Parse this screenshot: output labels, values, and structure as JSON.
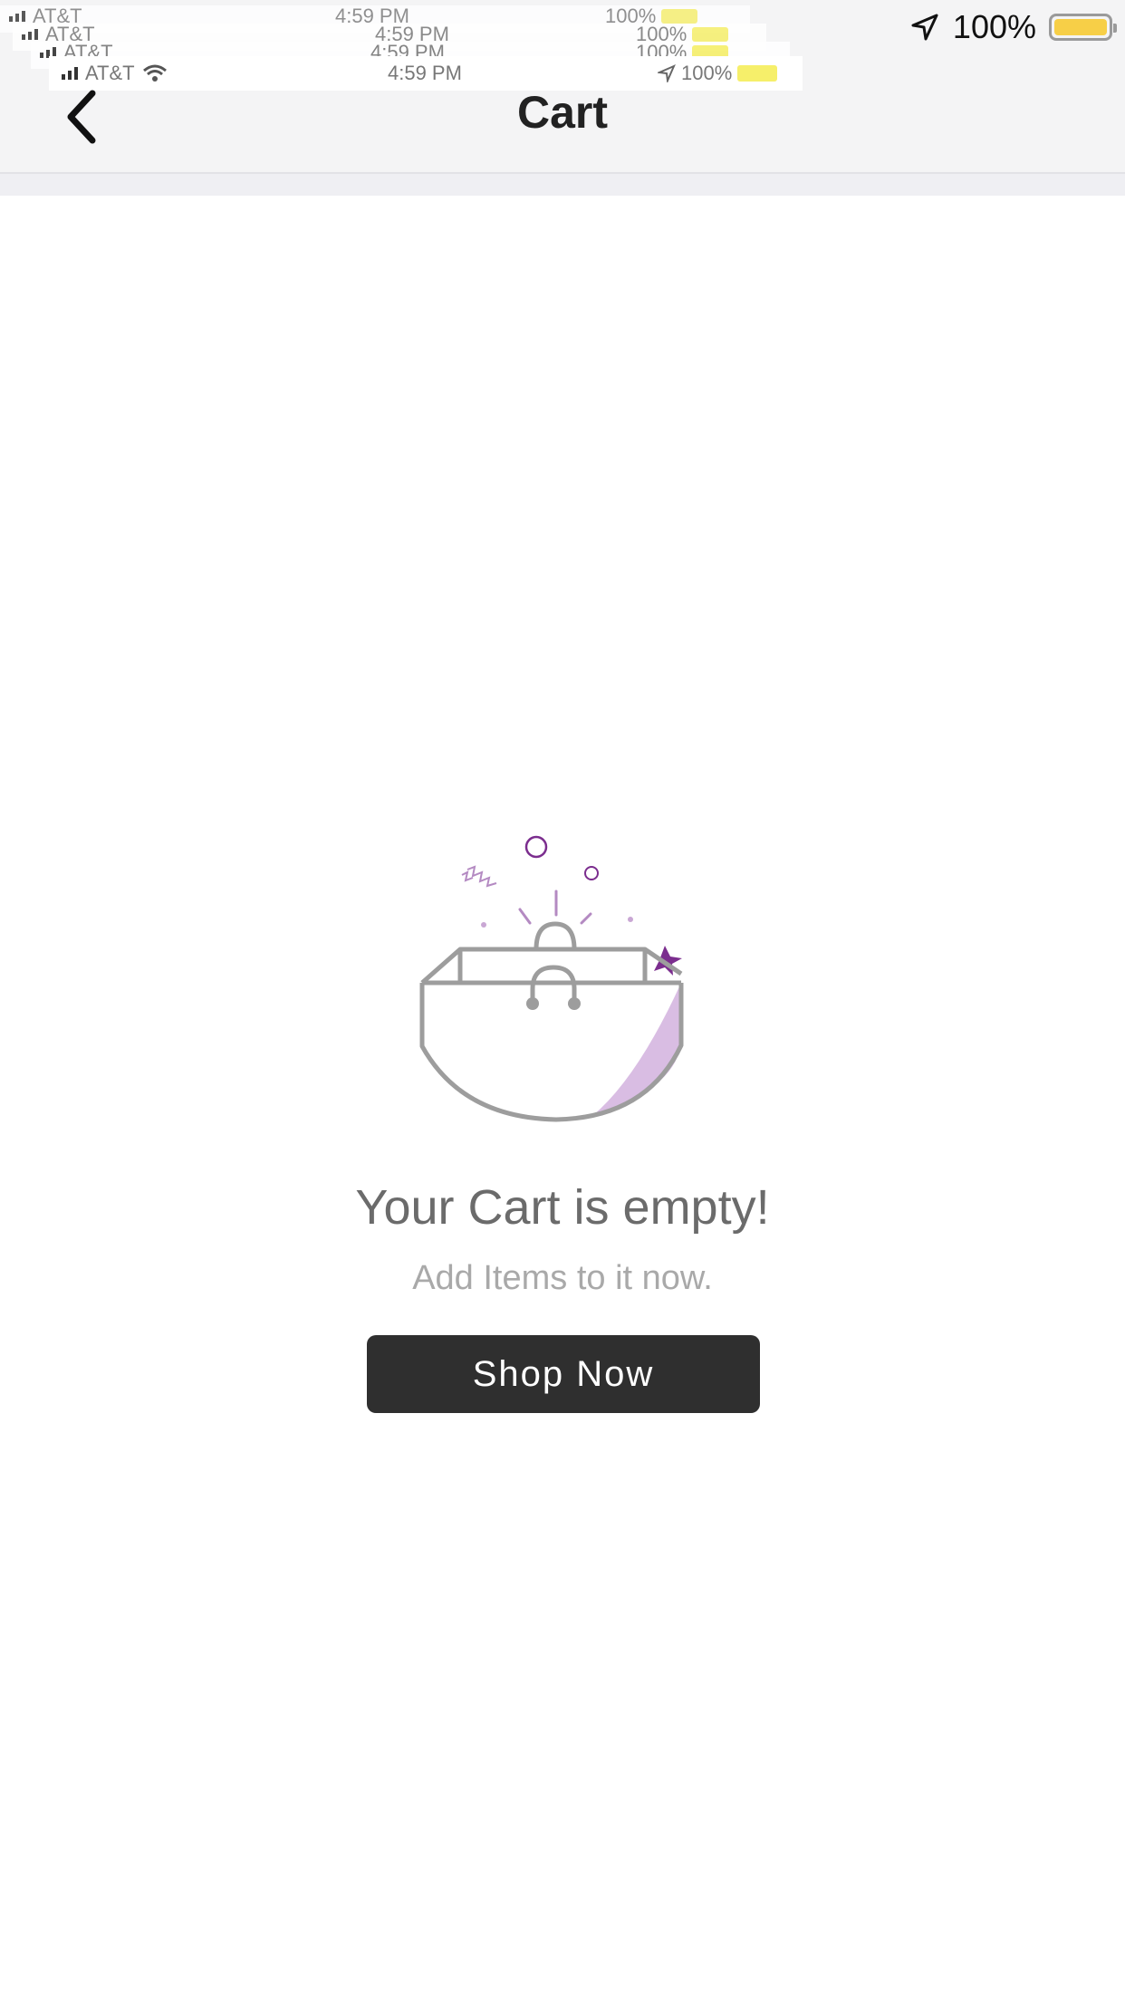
{
  "status_bar": {
    "carrier": "AT&T",
    "time": "4:59 PM",
    "battery_percent": "100%",
    "battery_level": 1.0,
    "battery_color": "#f7cf47"
  },
  "ghost_status": {
    "carrier": "AT&T",
    "time": "4:59 PM",
    "battery_percent": "100%"
  },
  "nav": {
    "title": "Cart",
    "back_icon": "chevron-left-icon"
  },
  "empty_state": {
    "illustration": "shopping-bag-icon",
    "title": "Your Cart is empty!",
    "subtitle": "Add Items to it now.",
    "button_label": "Shop Now"
  },
  "colors": {
    "accent_purple": "#7b2d8e",
    "light_purple": "#d9bde3",
    "button_bg": "#2f2f2f"
  }
}
